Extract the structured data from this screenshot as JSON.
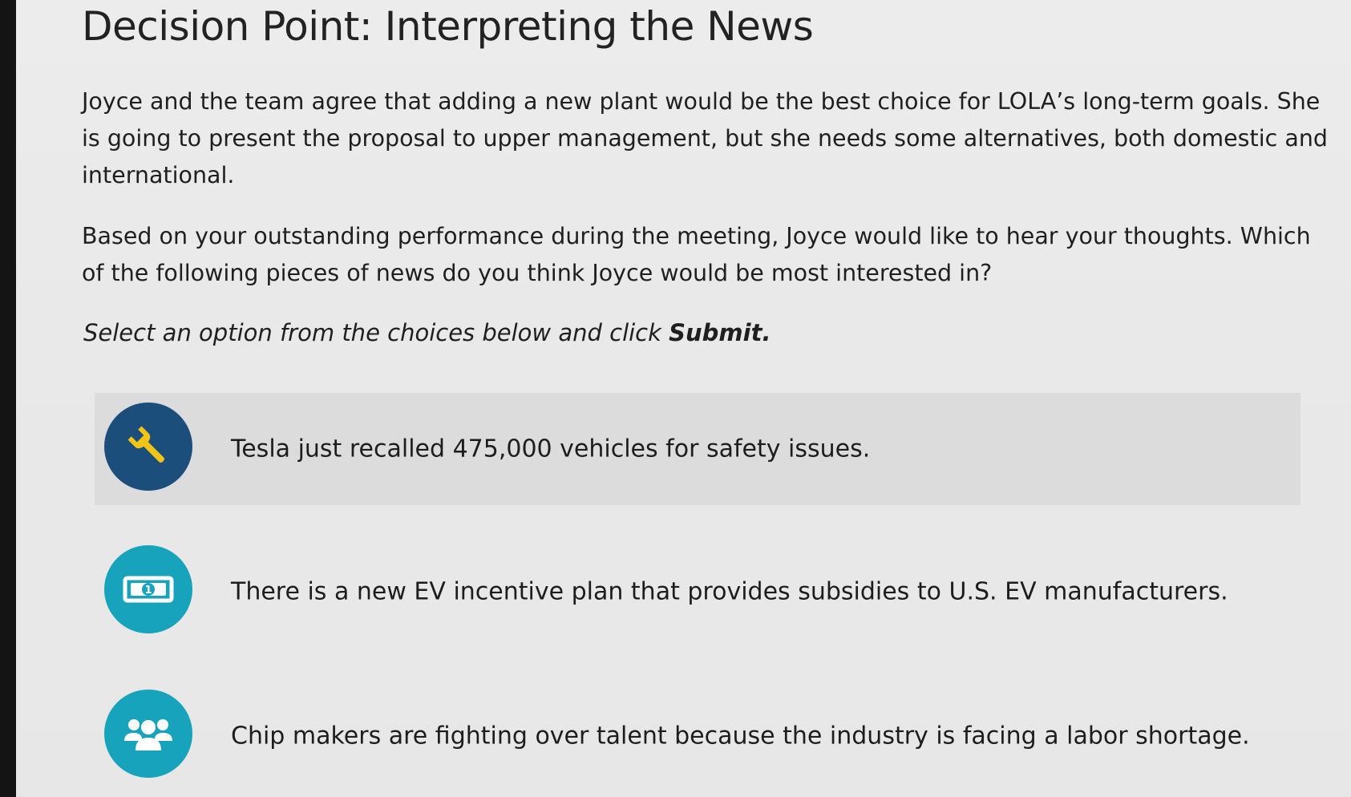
{
  "page": {
    "title": "Decision Point: Interpreting the News",
    "paragraph1": "Joyce and the team agree that adding a new plant would be the best choice for LOLA’s long-term goals. She is going to present the proposal to upper management, but she needs some alternatives, both domestic and international.",
    "paragraph2": "Based on your outstanding performance during the meeting, Joyce would like to hear your thoughts. Which of the following pieces of news do you think Joyce would be most interested in?",
    "instruction_prefix": "Select an option from the choices below and click ",
    "instruction_bold": "Submit."
  },
  "options": [
    {
      "text": "Tesla just recalled 475,000 vehicles for safety issues.",
      "icon": "wrench-icon",
      "icon_bg": "#1c4e7c",
      "icon_fg": "#f2c418",
      "selected": true
    },
    {
      "text": "There is a new EV incentive plan that provides subsidies to U.S. EV manufacturers.",
      "icon": "money-bill-icon",
      "icon_bg": "#17a3bb",
      "icon_fg": "#ffffff",
      "selected": false
    },
    {
      "text": "Chip makers are fighting over talent because the industry is facing a labor shortage.",
      "icon": "people-group-icon",
      "icon_bg": "#17a3bb",
      "icon_fg": "#ffffff",
      "selected": false
    }
  ]
}
